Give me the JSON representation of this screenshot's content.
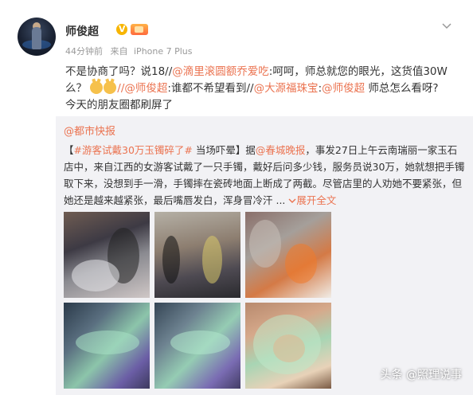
{
  "post": {
    "user_name": "师俊超",
    "time": "44分钟前",
    "source_prefix": "来自",
    "source": "iPhone 7 Plus",
    "text": {
      "p1": "不是协商了吗？说18//",
      "m1": "@滴里滚圆额乔爱吃",
      "p2": ":呵呵，师总就您的眼光，这货值30W么？",
      "emoji": [
        "cat-face-emoji",
        "cat-face-emoji"
      ],
      "m2": "//@师俊超",
      "p3": ":谁都不希望看到//",
      "m3": "@大源福珠宝",
      "p4": ":",
      "m4": "@师俊超",
      "p5": " 师总怎么看呀?",
      "p6": "今天的朋友圈都刷屏了"
    }
  },
  "repost": {
    "author": "@都市快报",
    "hashtag": "#游客试戴30万玉镯碎了#",
    "t1": " 当场吓晕】据",
    "mention": "@春城晚报",
    "t2": "，事发27日上午云南瑞丽一家玉石店中，来自江西的女游客试戴了一只手镯，戴好后问多少钱，服务员说30万，她就想把手镯取下来，没想到手一滑，手镯摔在瓷砖地面上断成了两截。尽管店里的人劝她不要紧张，但她还是越来越紧张，最后嘴唇发白，浑身冒冷汗 ...",
    "expand": "展开全文",
    "bracket_open": "【"
  },
  "watermark": "头条 @照理说事",
  "colors": {
    "accent": "#eb7350",
    "repost_bg": "#f2f2f5",
    "meta": "#999999"
  }
}
